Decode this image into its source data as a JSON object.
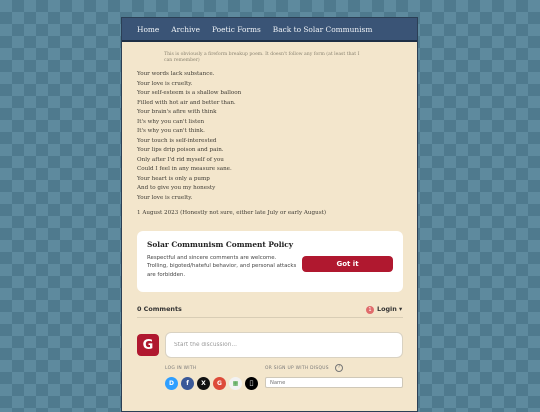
{
  "nav": {
    "items": [
      "Home",
      "Archive",
      "Poetic Forms",
      "Back to Solar Communism"
    ]
  },
  "post": {
    "note": "This is obviously a fireform breakup poem. It doesn't follow any form (at least that I can remember)",
    "lines": [
      "Your words lack substance.",
      "Your love is cruelty.",
      "Your self-esteem is a shallow balloon",
      "Filled with hot air and better than.",
      "Your brain's afire with think",
      "It's why you can't listen",
      "It's why you can't think.",
      "Your touch is self-interested",
      "Your lips drip poison and pain.",
      "Only after I'd rid myself of you",
      "Could I feel in any measure sane.",
      "Your heart is only a pump",
      "And to give you my honesty",
      "Your love is cruelty."
    ],
    "date": "1 August 2023 (Honestly not sure, either late July or early August)"
  },
  "policy": {
    "title": "Solar Communism Comment Policy",
    "body": "Respectful and sincere comments are welcome. Trolling, bigoted/hateful behavior, and personal attacks are forbidden.",
    "button": "Got it"
  },
  "comments": {
    "count": "0 Comments",
    "notifications": "1",
    "login": "Login ▾",
    "avatar_letter": "G",
    "placeholder": "Start the discussion...",
    "login_with": "LOG IN WITH",
    "or_signup": "OR SIGN UP WITH DISQUS",
    "help": "?",
    "name_placeholder": "Name",
    "socials": [
      {
        "letter": "D",
        "icon": "disqus-icon",
        "color": "#2e9fff"
      },
      {
        "letter": "f",
        "icon": "facebook-icon",
        "color": "#3b5998"
      },
      {
        "letter": "X",
        "icon": "x-icon",
        "color": "#111111"
      },
      {
        "letter": "G",
        "icon": "google-icon",
        "color": "#dd4b39"
      },
      {
        "letter": "▦",
        "icon": "microsoft-icon",
        "color": "#f2f2f2"
      },
      {
        "letter": "",
        "icon": "apple-icon",
        "color": "#000000"
      }
    ]
  },
  "colors": {
    "accent": "#b0182f",
    "nav": "#3a5476",
    "page": "#f3e6cc"
  }
}
